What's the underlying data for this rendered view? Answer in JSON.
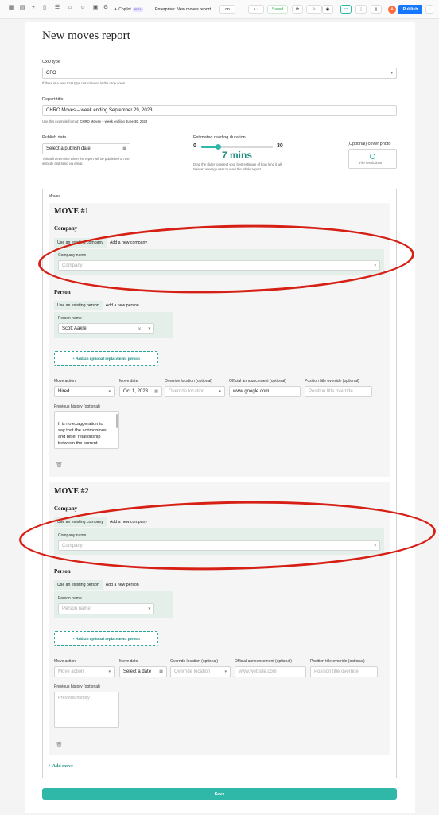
{
  "toolbar": {
    "copilot": "Copilot",
    "beta": "BETA",
    "breadcrumb": "Enterprise: New moves report",
    "toggle": "on",
    "saved": "Saved",
    "publish": "Publish",
    "avatar_initial": "A",
    "accent": "#2fb8a7",
    "publish_color": "#1677ff"
  },
  "page_title": "New moves report",
  "cxo": {
    "label": "CxO type",
    "value": "CFO",
    "help": "If there is a new CxO type not included in the drop down."
  },
  "report_title": {
    "label": "Report title",
    "value": "CHRO Moves – week ending September 29, 2023",
    "help_prefix": "Use this example format:",
    "help_example": "CHRO Moves – week ending June 30, 2023"
  },
  "publish_date": {
    "label": "Publish date",
    "placeholder": "Select a publish date",
    "help": "This will determine when the report will be published on the website and send via email."
  },
  "reading": {
    "label": "Estimated reading duration",
    "min": "0",
    "max": "30",
    "value": "7 mins",
    "level": 7,
    "help": "Drag the slider to select your best estimate of how long it will take an average user to read the whole report."
  },
  "cover": {
    "label": "(Optional) cover photo",
    "restrictions": "File restrictions"
  },
  "moves_label": "Moves",
  "moves": [
    {
      "title": "MOVE #1",
      "company_heading": "Company",
      "tab_existing_company": "Use an existing company",
      "tab_new_company": "Add a new company",
      "company_name_label": "Company name",
      "company_placeholder": "Company",
      "person_heading": "Person",
      "tab_existing_person": "Use an existing person",
      "tab_new_person": "Add a new person",
      "person_name_label": "Person name",
      "person_value": "Scott Aakre",
      "replacement": "+ Add an optional replacement person",
      "move_action_label": "Move action",
      "move_action_value": "Hired",
      "move_date_label": "Move date",
      "move_date_value": "Oct 1, 2023",
      "override_location_label": "Override location (optional)",
      "override_location_placeholder": "Override location",
      "official_label": "Official announcement (optional)",
      "official_value": "www.google.com",
      "position_label": "Position title override (optional)",
      "position_placeholder": "Position title override",
      "history_label": "Previous history (optional)",
      "history_value": "It is no exaggeration to say that the acrimonious and bitter relationship between the current"
    },
    {
      "title": "MOVE #2",
      "company_heading": "Company",
      "tab_existing_company": "Use an existing company",
      "tab_new_company": "Add a new company",
      "company_name_label": "Company name",
      "company_placeholder": "Company",
      "person_heading": "Person",
      "tab_existing_person": "Use an existing person",
      "tab_new_person": "Add a new person",
      "person_name_label": "Person name",
      "person_placeholder": "Person name",
      "replacement": "+ Add an optional replacement person",
      "move_action_label": "Move action",
      "move_action_placeholder": "Move action",
      "move_date_label": "Move date",
      "move_date_placeholder": "Select a date",
      "override_location_label": "Override location (optional)",
      "override_location_placeholder": "Override location",
      "official_label": "Official announcement (optional)",
      "official_placeholder": "www.website.com",
      "position_label": "Position title override (optional)",
      "position_placeholder": "Position title override",
      "history_label": "Previous history (optional)",
      "history_placeholder": "Previous history"
    }
  ],
  "add_move": "+ Add move",
  "save": "Save"
}
